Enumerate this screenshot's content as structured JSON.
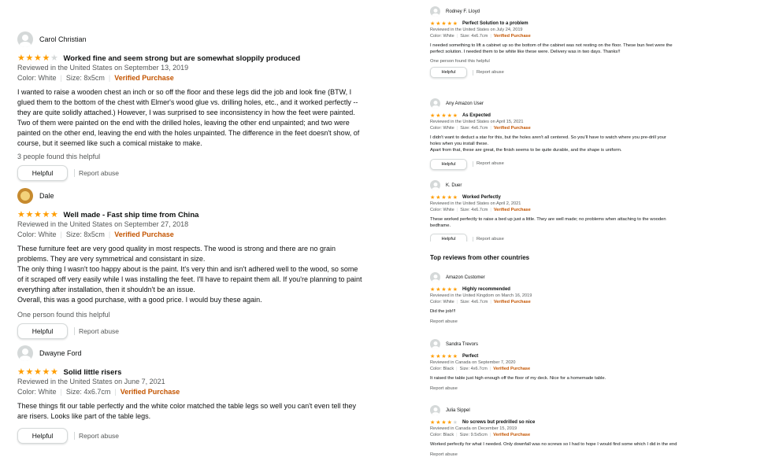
{
  "colors": {
    "star": "#ff9d00",
    "verified": "#c45500",
    "muted": "#565959",
    "border": "#d5d9d9"
  },
  "labels": {
    "helpful": "Helpful",
    "report": "Report abuse",
    "verified": "Verified Purchase"
  },
  "left_reviews": [
    {
      "name": "Carol Christian",
      "rating": 4,
      "title": "Worked fine and seem strong but are somewhat sloppily produced",
      "reviewed": "Reviewed in the United States on September 13, 2019",
      "color": "Color: White",
      "size": "Size: 8x5cm",
      "body": "I wanted to raise a wooden chest an inch or so off the floor and these legs did the job and look fine (BTW, I glued them to the bottom of the chest with Elmer's wood glue vs. drilling holes, etc., and it worked perfectly -- they are quite solidly attached.) However, I was surprised to see inconsistency in how the feet were painted. Two of them were painted on the end with the drilled holes, leaving the other end unpainted; and two were painted on the other end, leaving the end with the holes unpainted. The difference in the feet doesn't show, of course, but it seemed like such a comical mistake to make.",
      "helpful_count": "3 people found this helpful"
    },
    {
      "name": "Dale",
      "rating": 5,
      "title": "Well made - Fast ship time from China",
      "reviewed": "Reviewed in the United States on September 27, 2018",
      "color": "Color: White",
      "size": "Size: 8x5cm",
      "body": "These furniture feet are very good quality in most respects. The wood is strong and there are no grain problems. They are very symmetrical and consistant in size.\nThe only thing I wasn't too happy about is the paint. It's very thin and isn't adhered well to the wood, so some of it scraped off very easily while I was installing the feet. I'll have to repaint them all. If you're planning to paint everything after installation, then it shouldn't be an issue.\nOverall, this was a good purchase, with a good price. I would buy these again.",
      "helpful_count": "One person found this helpful"
    },
    {
      "name": "Dwayne Ford",
      "rating": 5,
      "title": "Solid little risers",
      "reviewed": "Reviewed in the United States on June 7, 2021",
      "color": "Color: White",
      "size": "Size: 4x6.7cm",
      "body": "These things fit our table perfectly and the white color matched the table legs so well you can't even tell they are risers. Looks like part of the table legs.",
      "helpful_count": ""
    }
  ],
  "right_reviews": [
    {
      "name": "Rodney F. Lloyd",
      "rating": 5,
      "title": "Perfect Solution to a problem",
      "reviewed": "Reviewed in the United States on July 24, 2019",
      "color": "Color: White",
      "size": "Size: 4x6.7cm",
      "body": "I needed something to lift a cabinet up so the bottom of the cabinet was not resting on the floor. These bun feet were the perfect solution. I needed them to be white like these were. Delivery was in two days. Thanks!!",
      "helpful_count": "One person found this helpful"
    },
    {
      "name": "Any Amazon User",
      "rating": 5,
      "title": "As Expected",
      "reviewed": "Reviewed in the United States on April 15, 2021",
      "color": "Color: White",
      "size": "Size: 4x6.7cm",
      "body": "I didn't want to deduct a star for this, but the holes aren't all centered. So you'll have to watch where you pre-drill your holes when you install these.\nApart from that, these are great, the finish seems to be quite durable, and the shape is uniform.",
      "helpful_count": ""
    },
    {
      "name": "K. Duer",
      "rating": 5,
      "title": "Worked Perfectly",
      "reviewed": "Reviewed in the United States on April 2, 2021",
      "color": "Color: White",
      "size": "Size: 4x6.7cm",
      "body": "These worked perfectly to raise a bed up just a little. They are well made; no problems when attaching to the wooden bedframe.",
      "helpful_count": ""
    }
  ],
  "other_countries_heading": "Top reviews from other countries",
  "other_reviews": [
    {
      "name": "Amazon Customer",
      "rating": 5,
      "title": "Highly recommended",
      "reviewed": "Reviewed in the United Kingdom on March 16, 2019",
      "color": "Color: White",
      "size": "Size: 4x6.7cm",
      "body": "Did the job!!!"
    },
    {
      "name": "Sandra Trevors",
      "rating": 5,
      "title": "Perfect",
      "reviewed": "Reviewed in Canada on September 7, 2020",
      "color": "Color: Black",
      "size": "Size: 4x6.7cm",
      "body": "It raised the table just high enough off the floor of my deck. Nice for a homemade table."
    },
    {
      "name": "Julia Sippel",
      "rating": 4,
      "title": "No screws but predrilled so nice",
      "reviewed": "Reviewed in Canada on December 15, 2019",
      "color": "Color: Black",
      "size": "Size: 9.5x5cm",
      "body": "Worked perfectly for what I needed. Only downfall was no screws so I had to hope I would find some which I did in the end"
    }
  ]
}
